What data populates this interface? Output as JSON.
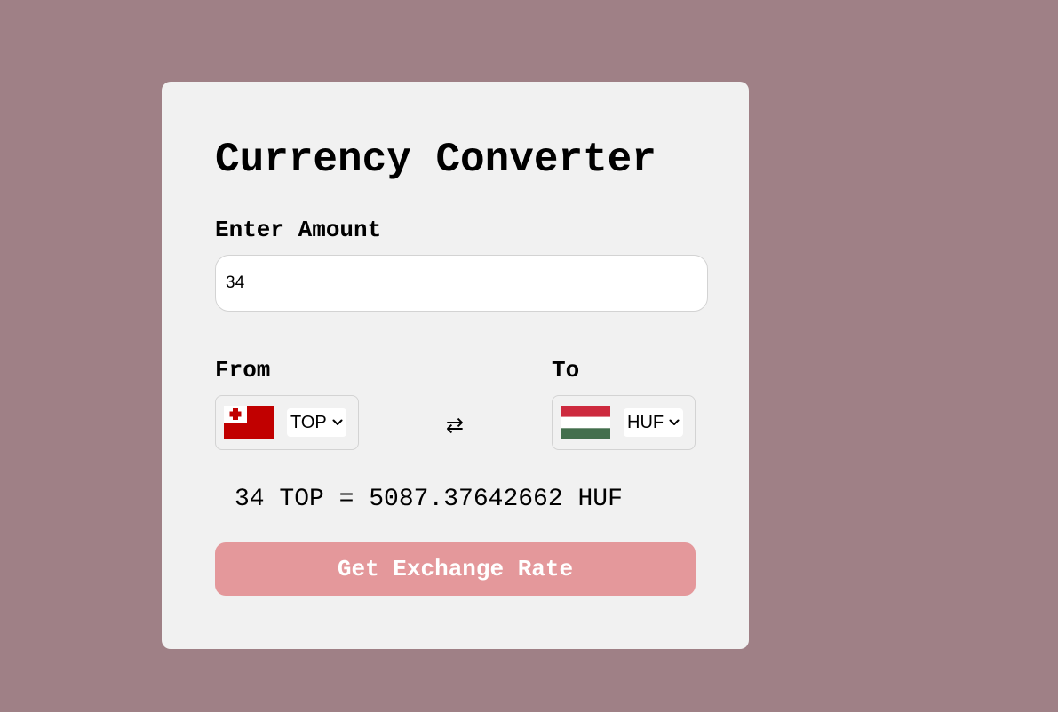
{
  "page": {
    "background_color": "#9f8086",
    "card_color": "#f1f1f1"
  },
  "converter": {
    "title": "Currency Converter",
    "amount_label": "Enter Amount",
    "amount_value": "34",
    "from_label": "From",
    "to_label": "To",
    "from_currency": "TOP",
    "to_currency": "HUF",
    "from_flag_icon": "tonga-flag-icon",
    "to_flag_icon": "hungary-flag-icon",
    "swap_icon_glyph": "⇄",
    "result_text": "34 TOP = 5087.37642662 HUF",
    "button_label": "Get Exchange Rate",
    "button_color": "#e4989b"
  }
}
